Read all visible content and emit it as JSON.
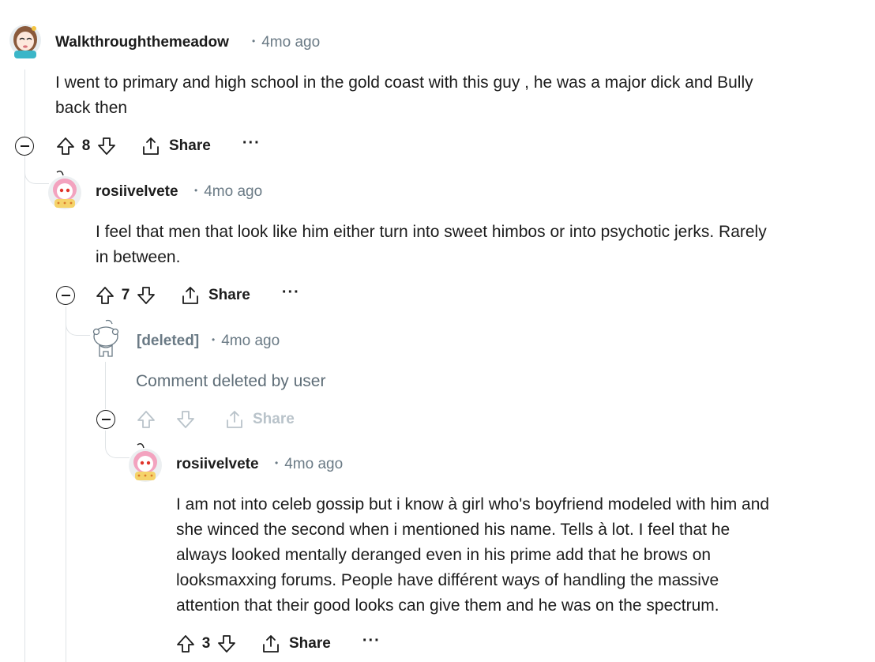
{
  "comments": [
    {
      "author": "Walkthroughthemeadow",
      "time": "4mo ago",
      "body_lines": [
        "I went to primary and high school in the gold coast with this guy , he was a major dick and Bully",
        "back then"
      ],
      "votes": "8",
      "share_label": "Share",
      "more_label": "···"
    },
    {
      "author": "rosiivelvete",
      "time": "4mo ago",
      "body_lines": [
        "I feel that men that look like him either turn into sweet himbos or into psychotic jerks. Rarely",
        "in between."
      ],
      "votes": "7",
      "share_label": "Share",
      "more_label": "···"
    },
    {
      "author": "[deleted]",
      "time": "4mo ago",
      "body_lines": [
        "Comment deleted by user"
      ],
      "votes": "",
      "share_label": "Share"
    },
    {
      "author": "rosiivelvete",
      "time": "4mo ago",
      "body_lines": [
        "I am not into celeb gossip but i know à girl who's boyfriend modeled with him and",
        "she winced the second when i mentioned his name. Tells à lot. I feel that he",
        "always looked mentally deranged even in his prime add that he brows on",
        "looksmaxxing forums. People have différent ways of handling the massive",
        "attention that their good looks can give them and he was on the spectrum."
      ],
      "votes": "3",
      "share_label": "Share",
      "more_label": "···"
    }
  ],
  "meta_separator": "•",
  "colors": {
    "text": "#1c1c1c",
    "meta": "#6a7a85",
    "thread_line": "#dfe3e6",
    "disabled": "#b9c3ca",
    "avatar_pink": "#f3a3bf",
    "avatar_hair": "#f06aa0"
  }
}
